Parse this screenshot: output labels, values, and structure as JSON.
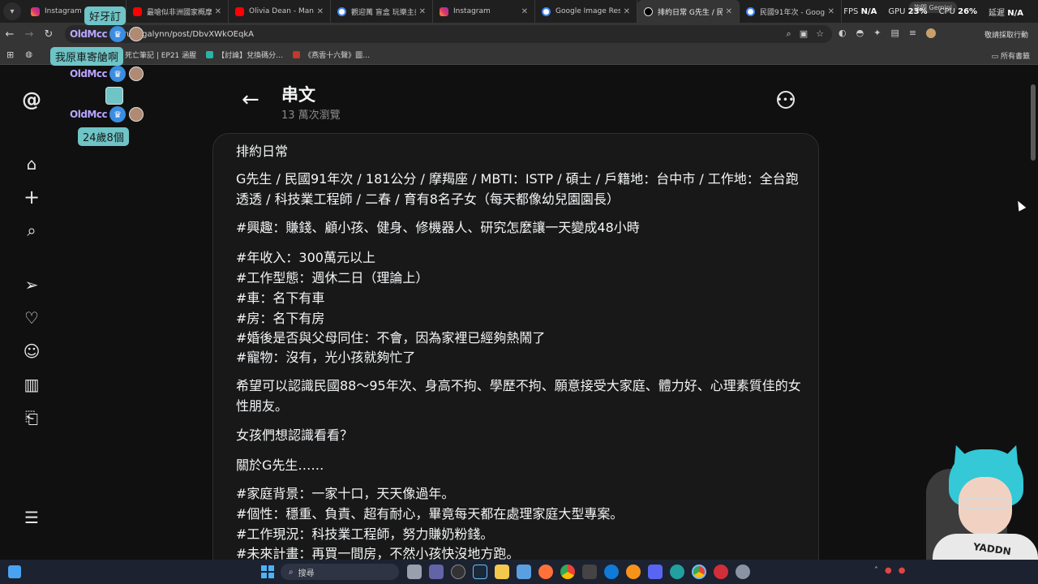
{
  "browser": {
    "tabs": [
      {
        "title": "Instagram",
        "fav": "ig",
        "active": false
      },
      {
        "title": "最嗆似非洲國家概摩治…",
        "fav": "yt",
        "active": false
      },
      {
        "title": "Olivia Dean - Man",
        "fav": "yt",
        "active": false
      },
      {
        "title": "觀迎萬 盲盒 玩樂主義",
        "fav": "gg",
        "active": false
      },
      {
        "title": "Instagram",
        "fav": "ig",
        "active": false
      },
      {
        "title": "Google Image Result",
        "fav": "gg",
        "active": false
      },
      {
        "title": "排約日常 G先生 / 民國",
        "fav": "th",
        "active": true
      },
      {
        "title": "民國91年次 - Google",
        "fav": "gg",
        "active": false
      }
    ],
    "tab_menu_icon": "chevron-down-icon",
    "close_glyph": "✕",
    "gemini_label": "詢問 Gemini",
    "stats": {
      "fps_label": "FPS",
      "fps_value": "N/A",
      "gpu_label": "GPU",
      "gpu_value": "23%",
      "cpu_label": "CPU",
      "cpu_value": "26%",
      "lat_label": "延遲",
      "lat_value": "N/A"
    },
    "url": "threads.com/@rugugalynn/post/DbvXWkOEqkA",
    "url_visible": "rugugalynn/post/DbvXWkOEqkA",
    "profile_label": "敬請採取行動",
    "bookmarks": [
      {
        "label": "死亡筆記 | EP21 涵腥",
        "color": "#555555"
      },
      {
        "label": "【討論】兌換碼分…",
        "color": "#2ab3a6"
      },
      {
        "label": "《燕雲十六聲》圖…",
        "color": "#c0392b"
      }
    ],
    "all_bookmarks": "所有書籤"
  },
  "overlay": {
    "bubbles": [
      "好牙訂",
      "我原車寄艙啊",
      "24歲8個"
    ],
    "nicks": [
      "OldMcc",
      "OldMcc",
      "OldMcc"
    ]
  },
  "threads": {
    "rail_icons": [
      "threads-logo-icon",
      "home-icon",
      "plus-icon",
      "search-icon",
      "send-icon",
      "heart-icon",
      "profile-icon",
      "insights-icon",
      "bookmark-icon",
      "menu-icon"
    ],
    "title": "串文",
    "views": "13 萬次瀏覽",
    "back_glyph": "←",
    "more_glyph": "•••"
  },
  "post": {
    "paragraphs": [
      "排約日常",
      "G先生 / 民國91年次 / 181公分 / 摩羯座 / MBTI：ISTP / 碩士 / 戶籍地：台中市 / 工作地：全台跑透透 / 科技業工程師 / 二春 / 育有8名子女（每天都像幼兒園園長）",
      "#興趣：賺錢、顧小孩、健身、修機器人、研究怎麼讓一天變成48小時",
      "#年收入：300萬元以上",
      "#工作型態：週休二日（理論上）",
      "#車：名下有車",
      "#房：名下有房",
      "#婚後是否與父母同住：不會，因為家裡已經夠熱鬧了",
      "#寵物：沒有，光小孩就夠忙了",
      "希望可以認識民國88～95年次、身高不拘、學歷不拘、願意接受大家庭、體力好、心理素質佳的女性朋友。",
      "女孩們想認識看看？",
      "關於G先生……",
      "#家庭背景：一家十口，天天像過年。",
      "#個性：穩重、負責、超有耐心，畢竟每天都在處理家庭大型專案。",
      "#工作現況：科技業工程師，努力賺奶粉錢。",
      "#未來計畫：再買一間房，不然小孩快沒地方跑。"
    ]
  },
  "cam": {
    "shirt_text": "YADDN"
  },
  "taskbar": {
    "search_placeholder": "搜尋"
  }
}
